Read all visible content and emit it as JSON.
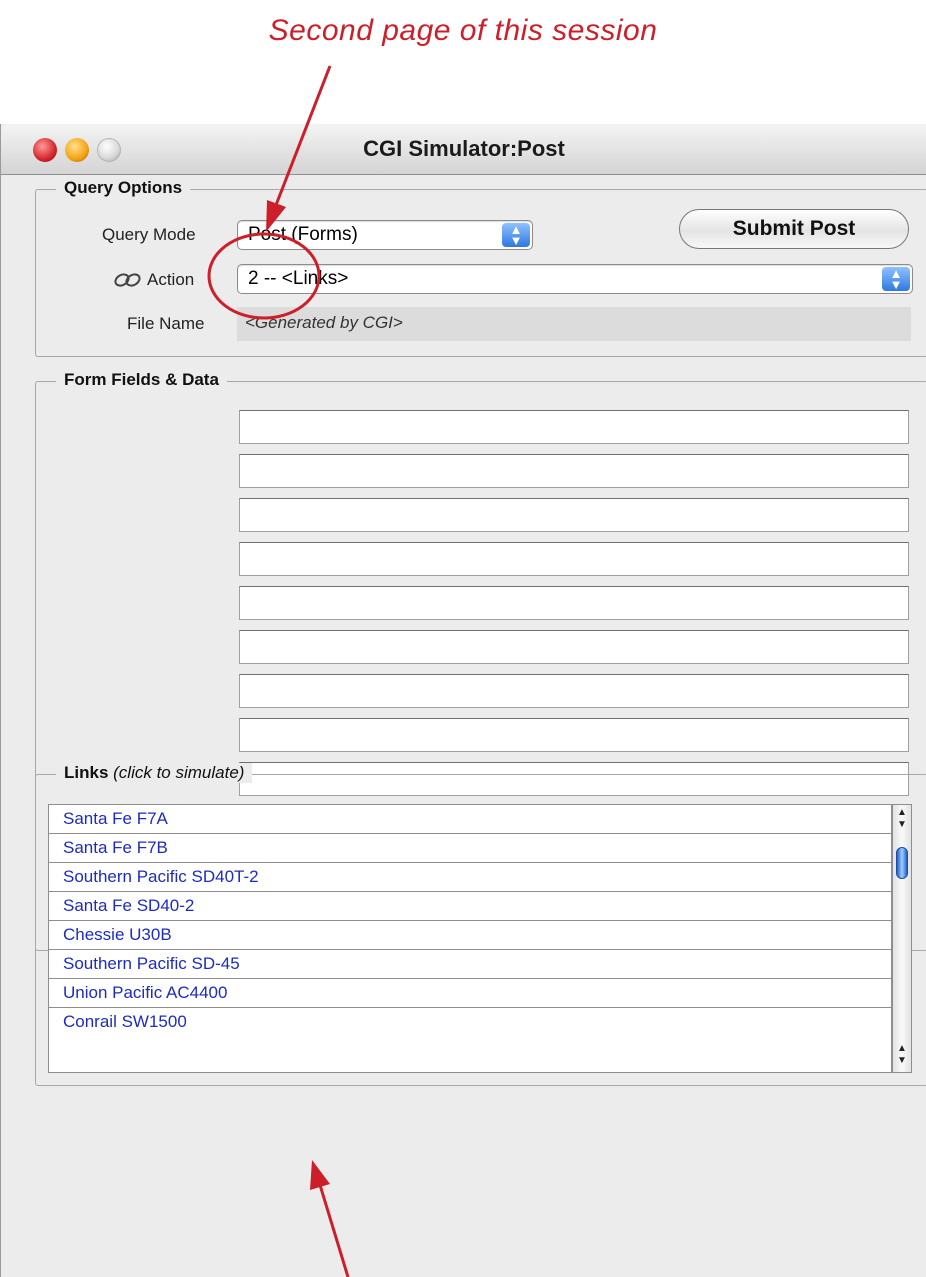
{
  "annotation": {
    "caption": "Second page of this session",
    "color": "#cc1f2a"
  },
  "window": {
    "title": "CGI Simulator:Post"
  },
  "query_options": {
    "group_label": "Query Options",
    "query_mode_label": "Query Mode",
    "query_mode_value": "Post (Forms)",
    "submit_label": "Submit Post",
    "action_label": "Action",
    "action_icon": "link-chain-icon",
    "action_value": "2 -- <Links>",
    "file_name_label": "File Name",
    "file_name_value": "<Generated by CGI>"
  },
  "form_fields": {
    "group_label": "Form Fields & Data",
    "fields": [
      "",
      "",
      "",
      "",
      "",
      "",
      "",
      "",
      "",
      "",
      "",
      ""
    ]
  },
  "links": {
    "group_label": "Links",
    "group_hint": "(click to simulate)",
    "items": [
      "Santa Fe F7A",
      "Santa Fe F7B",
      "Southern Pacific SD40T-2",
      "Santa Fe SD40-2",
      "Chessie U30B",
      "Southern Pacific SD-45",
      "Union Pacific AC4400",
      "Conrail SW1500"
    ],
    "link_color": "#1d2bbf"
  },
  "scrollbar": {
    "up_icon": "scroll-up-arrow-icon",
    "down_icon": "scroll-down-arrow-icon"
  }
}
